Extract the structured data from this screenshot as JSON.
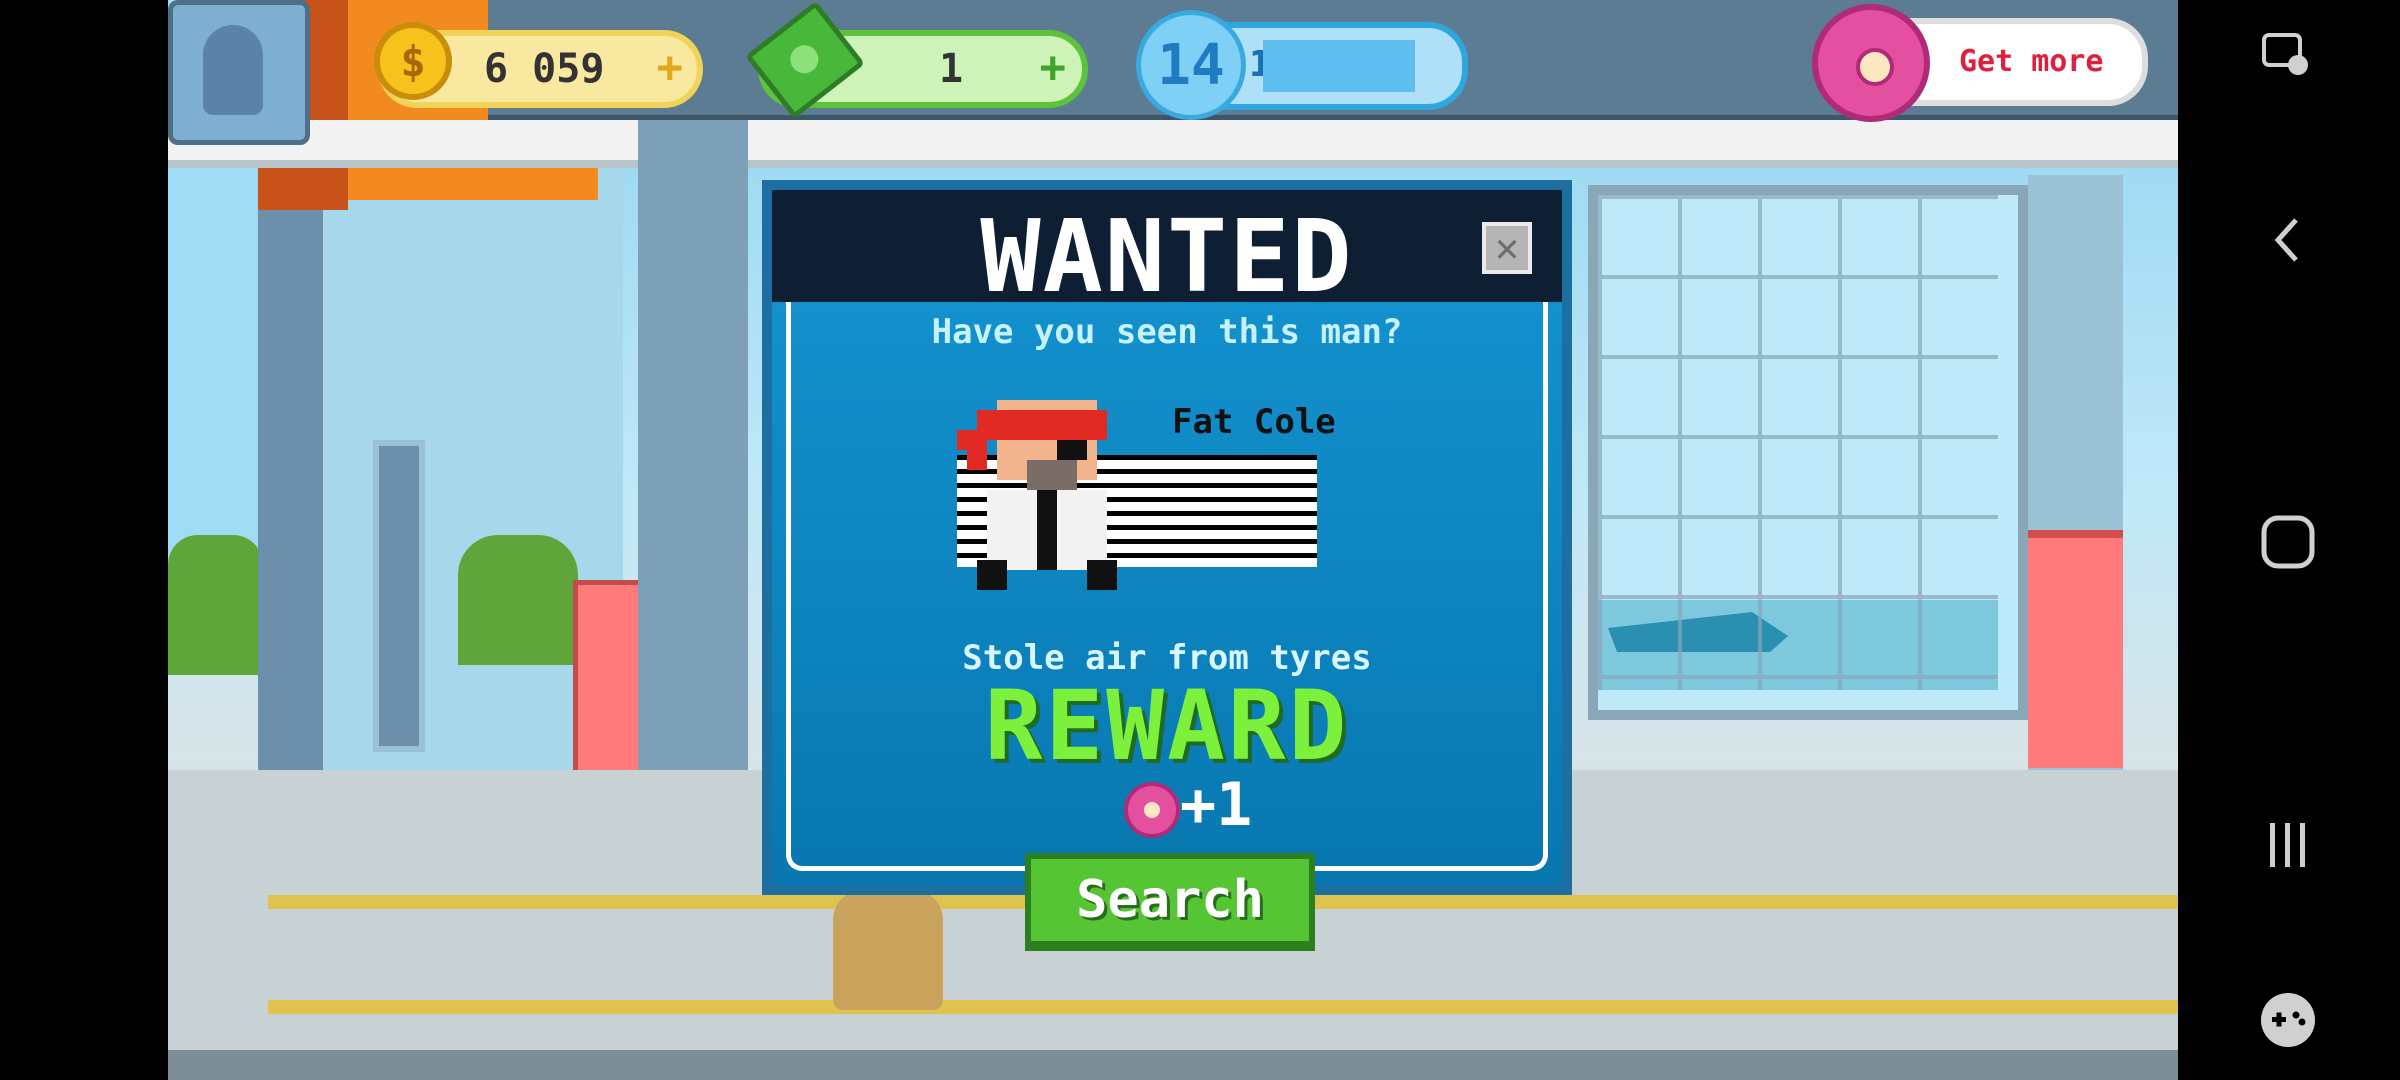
{
  "hud": {
    "coins": "6 059",
    "coins_plus": "+",
    "coin_symbol": "$",
    "cash": "1",
    "cash_plus": "+",
    "level": "14",
    "xp": "11633xp",
    "donut_cta": "Get more"
  },
  "modal": {
    "title": "WANTED",
    "close_symbol": "✕",
    "subtitle": "Have you seen this man?",
    "suspect_name": "Fat Cole",
    "crime": "Stole air from tyres",
    "reward_label": "REWARD",
    "reward_amount": "+1",
    "search_label": "Search"
  },
  "navbar": {
    "icons": [
      "screenshot-edit-icon",
      "back-icon",
      "home-icon",
      "recents-icon",
      "game-tools-icon"
    ]
  },
  "colors": {
    "modal_blue": "#1596d3",
    "header_dark": "#0e1e33",
    "reward_green": "#7cf03b",
    "button_green": "#55c533",
    "donut_pink": "#e44f9f",
    "coin_gold": "#f6c21b"
  }
}
